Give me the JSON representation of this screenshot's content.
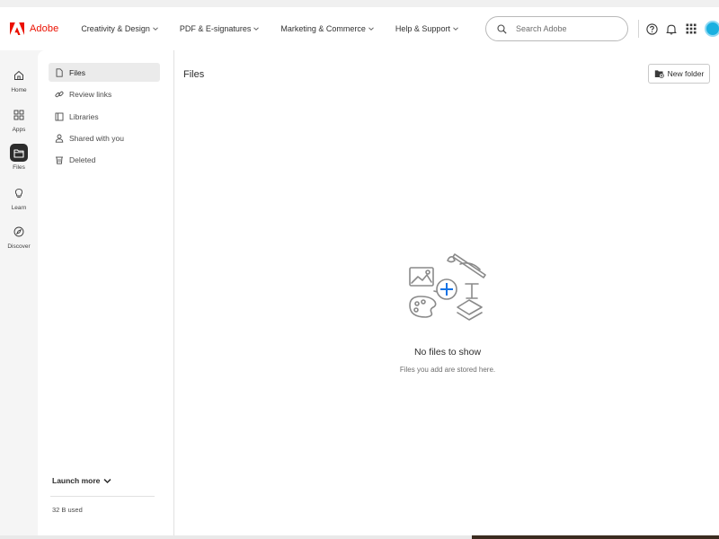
{
  "header": {
    "brand": "Adobe",
    "nav": [
      "Creativity & Design",
      "PDF & E-signatures",
      "Marketing & Commerce",
      "Help & Support"
    ],
    "search_placeholder": "Search Adobe"
  },
  "rail": {
    "items": [
      {
        "label": "Home",
        "icon": "home-icon"
      },
      {
        "label": "Apps",
        "icon": "apps-icon"
      },
      {
        "label": "Files",
        "icon": "folder-icon",
        "active": true
      },
      {
        "label": "Learn",
        "icon": "lightbulb-icon"
      },
      {
        "label": "Discover",
        "icon": "compass-icon"
      }
    ]
  },
  "sidebar": {
    "items": [
      {
        "label": "Files",
        "icon": "file-icon",
        "active": true
      },
      {
        "label": "Review links",
        "icon": "link-icon"
      },
      {
        "label": "Libraries",
        "icon": "library-icon"
      },
      {
        "label": "Shared with you",
        "icon": "shared-icon"
      },
      {
        "label": "Deleted",
        "icon": "trash-icon"
      }
    ],
    "launch_more": "Launch more",
    "storage": "32 B used"
  },
  "main": {
    "title": "Files",
    "new_folder_label": "New folder",
    "empty_title": "No files to show",
    "empty_subtitle": "Files you add are stored here."
  },
  "colors": {
    "brand_red": "#eb1000",
    "accent_blue": "#1473e6",
    "active_rail": "#2c2c2c"
  }
}
